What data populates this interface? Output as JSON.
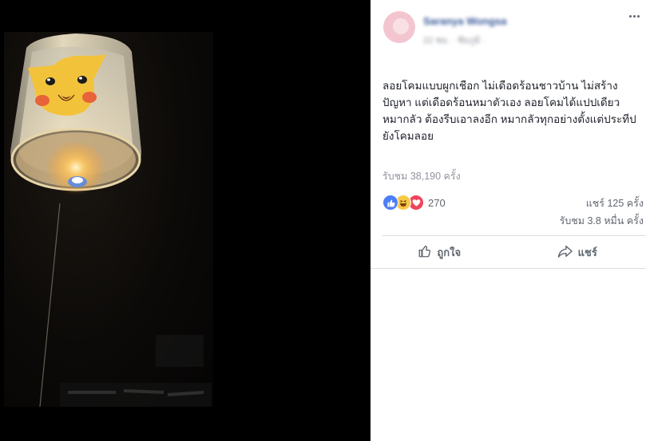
{
  "post": {
    "author": "Saranya Wongsa",
    "meta": "22 ชม. · ชัยภูมิ ·",
    "text": "ลอยโคมแบบผูกเชือก ไม่เดือดร้อนชาวบ้าน ไม่สร้างปัญหา แต่เดือดร้อนหมาตัวเอง ลอยโคมได้แปปเดียว หมากลัว ต้องรีบเอาลงอีก หมากลัวทุกอย่างตั้งแต่ประทีปยังโคมลอย",
    "views_text": "รับชม 38,190 ครั้ง"
  },
  "stats": {
    "reaction_count": "270",
    "shares_text": "แชร์ 125 ครั้ง",
    "views_short_text": "รับชม 3.8 หมื่น ครั้ง"
  },
  "actions": {
    "like_label": "ถูกใจ",
    "share_label": "แชร์"
  },
  "icons": {
    "reactions": [
      "like-icon",
      "haha-icon",
      "love-icon"
    ],
    "more": "more-options-icon"
  },
  "colors": {
    "link": "#385898",
    "like": "#4c7ef5",
    "love": "#f0445d",
    "haha": "#f7c947"
  }
}
